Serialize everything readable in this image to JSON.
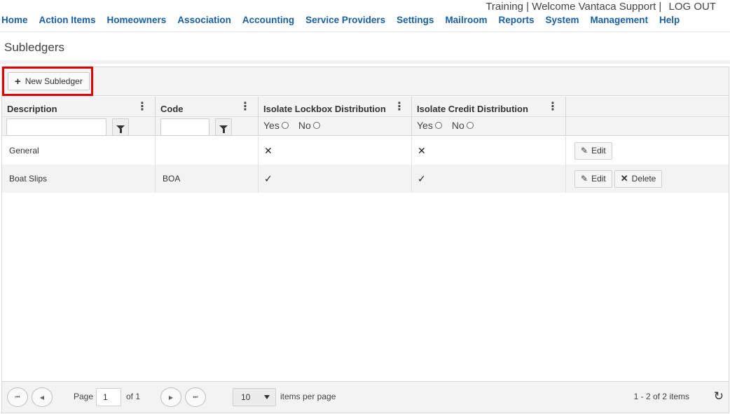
{
  "header": {
    "user_text": "Training | Welcome Vantaca Support |",
    "logout": "LOG OUT"
  },
  "nav": [
    "Home",
    "Action Items",
    "Homeowners",
    "Association",
    "Accounting",
    "Service Providers",
    "Settings",
    "Mailroom",
    "Reports",
    "System",
    "Management",
    "Help"
  ],
  "page": {
    "title": "Subledgers"
  },
  "toolbar": {
    "new_label": "New Subledger"
  },
  "columns": {
    "description": "Description",
    "code": "Code",
    "lockbox": "Isolate Lockbox Distribution",
    "credit": "Isolate Credit Distribution"
  },
  "filter": {
    "yes": "Yes",
    "no": "No"
  },
  "rows": [
    {
      "description": "General",
      "code": "",
      "lockbox": "✕",
      "credit": "✕",
      "edit": "Edit"
    },
    {
      "description": "Boat Slips",
      "code": "BOA",
      "lockbox": "✓",
      "credit": "✓",
      "edit": "Edit",
      "delete": "Delete"
    }
  ],
  "pager": {
    "page_label": "Page",
    "page_value": "1",
    "of_label": "of 1",
    "page_size": "10",
    "per_page_label": "items per page",
    "summary": "1 - 2 of 2 items"
  },
  "icons": {
    "plus": "+",
    "kebab": "⋮",
    "pencil": "✎",
    "delete_x": "✕",
    "first": "⏮",
    "prev": "◀",
    "next": "▶",
    "last": "⏭",
    "refresh": "↻"
  }
}
